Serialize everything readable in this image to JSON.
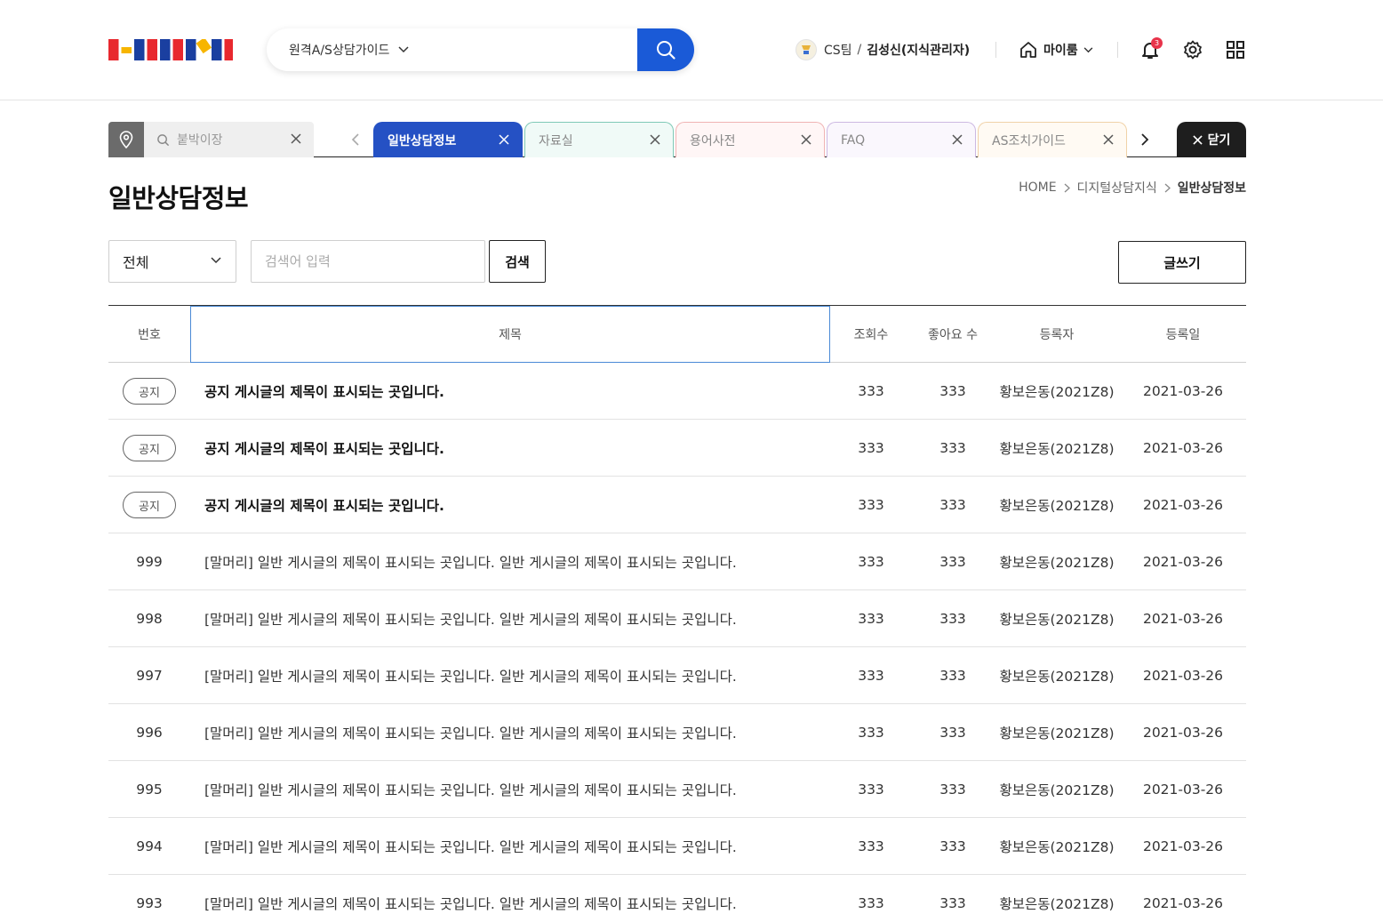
{
  "header": {
    "category_select": "원격A/S상담가이드",
    "user_team": "CS팀",
    "user_slash": "/",
    "user_name": "김성신(지식관리자)",
    "myroom_label": "마이룸",
    "notification_count": "3",
    "logo_colors": [
      "#e8282e",
      "#f7b500",
      "#1a3fa0",
      "#e8282e",
      "#1a3fa0",
      "#e8282e",
      "#1a3fa0",
      "#f7b500",
      "#1a3fa0",
      "#e8282e"
    ]
  },
  "tabs": {
    "pinned_placeholder": "붙박이장",
    "items": [
      {
        "label": "일반상담정보",
        "color": "#2551c4",
        "bg": "#2551c4",
        "active": true
      },
      {
        "label": "자료실",
        "color": "#7fc9b6",
        "bg": "#f0faf7",
        "active": false
      },
      {
        "label": "용어사전",
        "color": "#f0b3b3",
        "bg": "#fff6f6",
        "active": false
      },
      {
        "label": "FAQ",
        "color": "#cdb9e2",
        "bg": "#faf7fd",
        "active": false
      },
      {
        "label": "AS조치가이드",
        "color": "#f0d2a8",
        "bg": "#fffaf3",
        "active": false
      }
    ],
    "close_label": "닫기"
  },
  "page": {
    "title": "일반상담정보",
    "breadcrumb": [
      "HOME",
      "디지털상담지식",
      "일반상담정보"
    ]
  },
  "filter": {
    "category": "전체",
    "keyword_placeholder": "검색어 입력",
    "search_label": "검색",
    "write_label": "글쓰기"
  },
  "table": {
    "headers": [
      "번호",
      "제목",
      "조회수",
      "좋아요 수",
      "등록자",
      "등록일"
    ],
    "rows": [
      {
        "no": "공지",
        "notice": true,
        "title": "공지 게시글의 제목이 표시되는 곳입니다.",
        "views": "333",
        "likes": "333",
        "author": "황보은동(2021Z8)",
        "date": "2021-03-26"
      },
      {
        "no": "공지",
        "notice": true,
        "title": "공지 게시글의 제목이 표시되는 곳입니다.",
        "views": "333",
        "likes": "333",
        "author": "황보은동(2021Z8)",
        "date": "2021-03-26"
      },
      {
        "no": "공지",
        "notice": true,
        "title": "공지 게시글의 제목이 표시되는 곳입니다.",
        "views": "333",
        "likes": "333",
        "author": "황보은동(2021Z8)",
        "date": "2021-03-26"
      },
      {
        "no": "999",
        "notice": false,
        "title": "[말머리] 일반 게시글의 제목이 표시되는 곳입니다. 일반 게시글의 제목이 표시되는 곳입니다.",
        "views": "333",
        "likes": "333",
        "author": "황보은동(2021Z8)",
        "date": "2021-03-26"
      },
      {
        "no": "998",
        "notice": false,
        "title": "[말머리] 일반 게시글의 제목이 표시되는 곳입니다. 일반 게시글의 제목이 표시되는 곳입니다.",
        "views": "333",
        "likes": "333",
        "author": "황보은동(2021Z8)",
        "date": "2021-03-26"
      },
      {
        "no": "997",
        "notice": false,
        "title": "[말머리] 일반 게시글의 제목이 표시되는 곳입니다. 일반 게시글의 제목이 표시되는 곳입니다.",
        "views": "333",
        "likes": "333",
        "author": "황보은동(2021Z8)",
        "date": "2021-03-26"
      },
      {
        "no": "996",
        "notice": false,
        "title": "[말머리] 일반 게시글의 제목이 표시되는 곳입니다. 일반 게시글의 제목이 표시되는 곳입니다.",
        "views": "333",
        "likes": "333",
        "author": "황보은동(2021Z8)",
        "date": "2021-03-26"
      },
      {
        "no": "995",
        "notice": false,
        "title": "[말머리] 일반 게시글의 제목이 표시되는 곳입니다. 일반 게시글의 제목이 표시되는 곳입니다.",
        "views": "333",
        "likes": "333",
        "author": "황보은동(2021Z8)",
        "date": "2021-03-26"
      },
      {
        "no": "994",
        "notice": false,
        "title": "[말머리] 일반 게시글의 제목이 표시되는 곳입니다. 일반 게시글의 제목이 표시되는 곳입니다.",
        "views": "333",
        "likes": "333",
        "author": "황보은동(2021Z8)",
        "date": "2021-03-26"
      },
      {
        "no": "993",
        "notice": false,
        "title": "[말머리] 일반 게시글의 제목이 표시되는 곳입니다. 일반 게시글의 제목이 표시되는 곳입니다.",
        "views": "333",
        "likes": "333",
        "author": "황보은동(2021Z8)",
        "date": "2021-03-26"
      }
    ]
  }
}
